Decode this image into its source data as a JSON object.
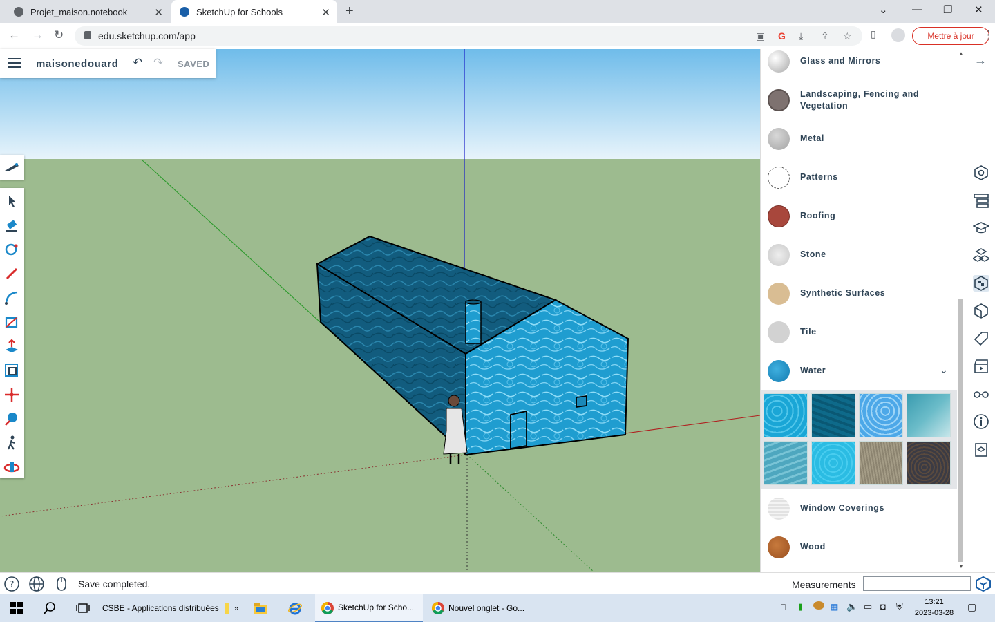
{
  "browser": {
    "tabs": [
      {
        "title": "Projet_maison.notebook",
        "active": false
      },
      {
        "title": "SketchUp for Schools",
        "active": true
      }
    ],
    "url": "edu.sketchup.com/app",
    "update_button": "Mettre à jour"
  },
  "app": {
    "project_name": "maisonedouard",
    "save_state": "SAVED"
  },
  "materials": {
    "categories": [
      {
        "label": "Glass and Mirrors",
        "color": "#c4c4c4"
      },
      {
        "label": "Landscaping, Fencing and Vegetation",
        "color": "#7e7270"
      },
      {
        "label": "Metal",
        "color": "#b9b9b9"
      },
      {
        "label": "Patterns",
        "color": "#ffffff"
      },
      {
        "label": "Roofing",
        "color": "#a8473c"
      },
      {
        "label": "Stone",
        "color": "#d5d5d5"
      },
      {
        "label": "Synthetic Surfaces",
        "color": "#d9bd93"
      },
      {
        "label": "Tile",
        "color": "#d2d2d2"
      },
      {
        "label": "Water",
        "color": "#1e8cc3"
      },
      {
        "label": "Window Coverings",
        "color": "#e2e2e2"
      },
      {
        "label": "Wood",
        "color": "#ad5e27"
      }
    ],
    "expanded": "Water",
    "water_swatches": [
      "#1aa6d6",
      "#0e6a8a",
      "#4da8e8",
      "#6bbcc9",
      "#4ea7bf",
      "#2bbce3",
      "#8c8470",
      "#4a4a52"
    ]
  },
  "status": {
    "message": "Save completed.",
    "measurements_label": "Measurements",
    "measurements_value": ""
  },
  "taskbar": {
    "csbe": "CSBE - Applications distribuées",
    "sketchup": "SketchUp for Scho...",
    "newtab": "Nouvel onglet - Go...",
    "time": "13:21",
    "date": "2023-03-28"
  }
}
